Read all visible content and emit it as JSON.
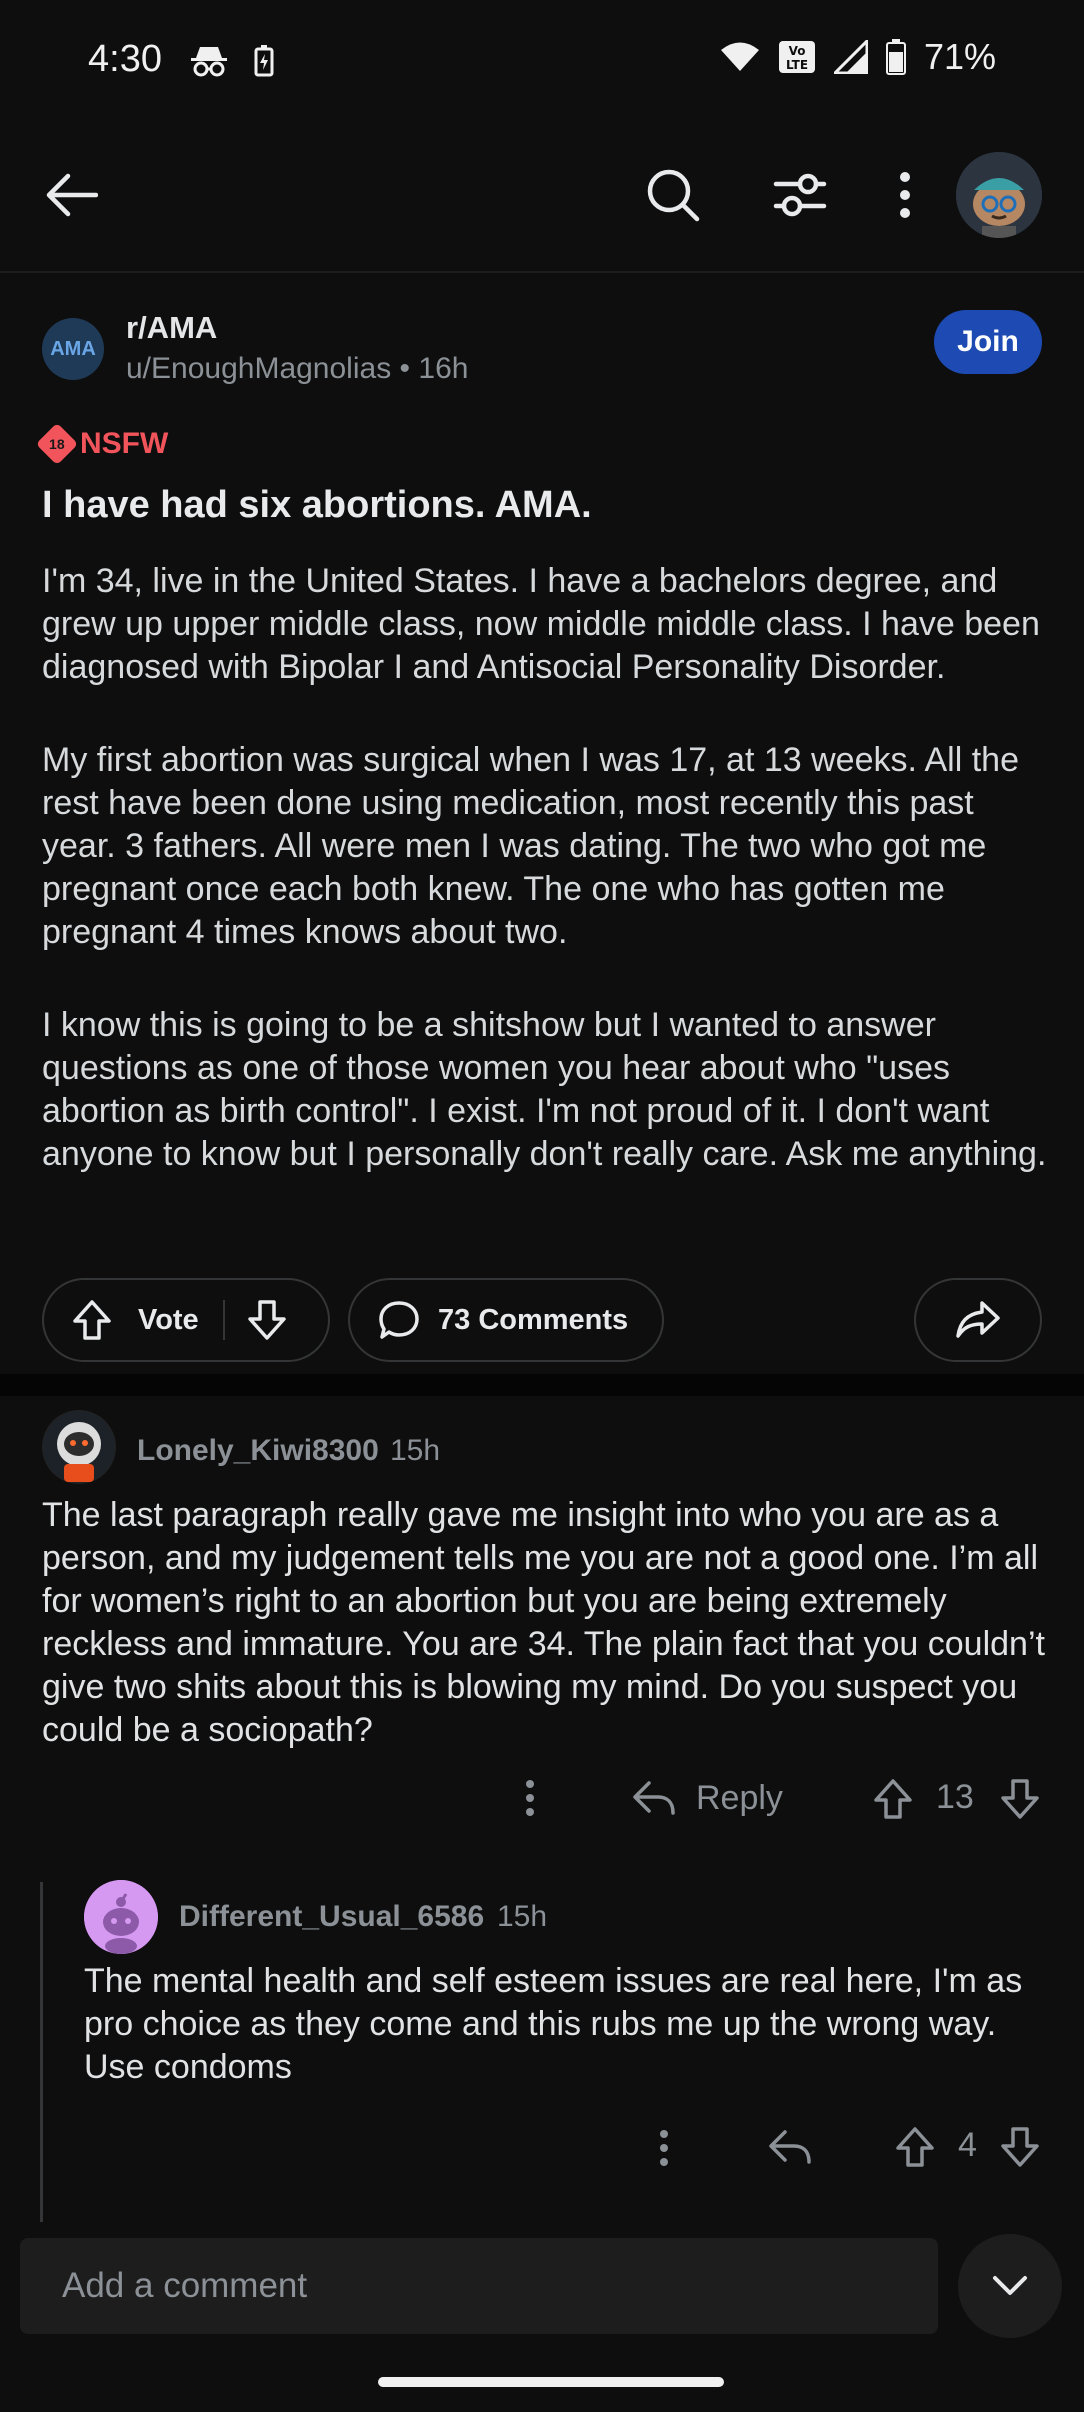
{
  "status_bar": {
    "time": "4:30",
    "battery": "71%",
    "icons": [
      "incognito-icon",
      "battery-saver-icon",
      "wifi-icon",
      "volte-icon",
      "signal-icon",
      "battery-icon"
    ]
  },
  "app_bar": {
    "icons": [
      "back-arrow-icon",
      "search-icon",
      "sort-filter-icon",
      "more-options-icon"
    ]
  },
  "post": {
    "subreddit": "r/AMA",
    "subreddit_avatar_text": "AMA",
    "author": "u/EnoughMagnolias",
    "age": "16h",
    "join_label": "Join",
    "nsfw_label": "NSFW",
    "nsfw_badge": "18",
    "title": "I have had six abortions. AMA.",
    "paragraphs": [
      "I'm 34, live in the United States. I have a bachelors degree, and grew up upper middle class, now middle middle class. I have been diagnosed with Bipolar I and Antisocial Personality Disorder.",
      "My first abortion was surgical when I was 17, at 13 weeks. All the rest have been done using medication, most recently this past year. 3 fathers. All were men I was dating. The two who got me pregnant once each both knew. The one who has gotten me pregnant 4 times knows about two.",
      "I know this is going to be a shitshow but I wanted to answer questions as one of those women you hear about who \"uses abortion as birth control\". I exist. I'm not proud of it. I don't want anyone to know but I personally don't really care. Ask me anything."
    ],
    "vote_label": "Vote",
    "comments_label": "73 Comments"
  },
  "comments": [
    {
      "author": "Lonely_Kiwi8300",
      "age": "15h",
      "body": "The last paragraph really gave me insight into who you are as a person, and my judgement tells me you are not a good one. I’m all for women’s right to an abortion but you are being extremely reckless and immature. You are 34. The plain fact that you couldn’t give two shits about this is blowing my mind. Do you suspect you could be a sociopath?",
      "reply_label": "Reply",
      "score": "13"
    },
    {
      "author": "Different_Usual_6586",
      "age": "15h",
      "body": "The mental health and self esteem issues are real here, I'm as pro choice as they come and this rubs me up the wrong way. Use condoms",
      "score": "4"
    }
  ],
  "comment_bar": {
    "placeholder": "Add a comment"
  },
  "colors": {
    "background": "#0e0e0e",
    "join_button": "#1d4bb3",
    "nsfw": "#f2545b",
    "muted_text": "#8b9196"
  }
}
